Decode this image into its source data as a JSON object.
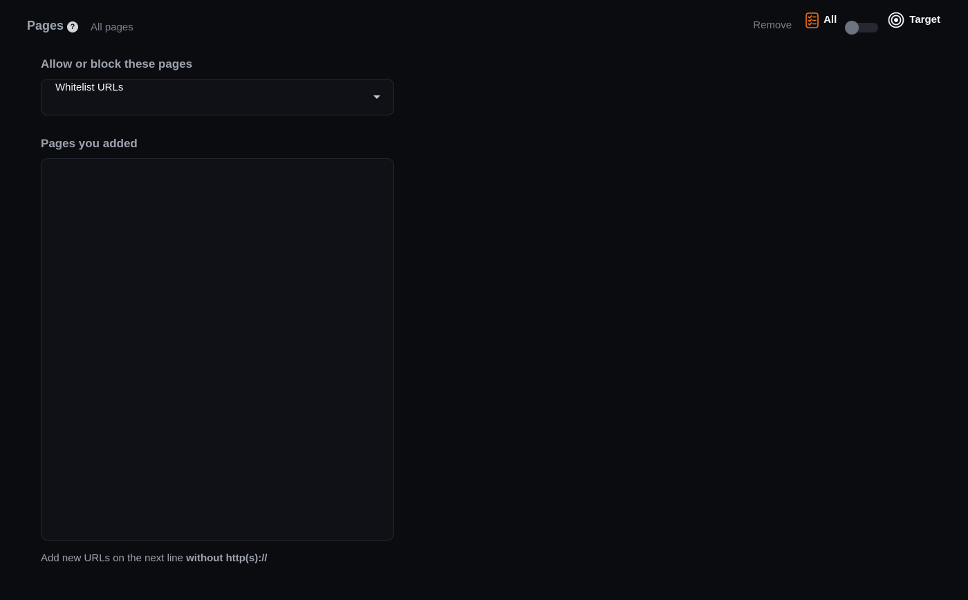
{
  "header": {
    "title": "Pages",
    "help_icon": "question-circle-icon",
    "subtitle": "All pages",
    "remove_label": "Remove",
    "all_label": "All",
    "all_icon": "checklist-icon",
    "target_label": "Target",
    "target_icon": "target-icon",
    "toggle_on": false
  },
  "form": {
    "allow_block_label": "Allow or block these pages",
    "select_value": "Whitelist URLs",
    "pages_added_label": "Pages you added",
    "pages_textarea_value": "",
    "helper_prefix": "Add new URLs on the next line ",
    "helper_bold": "without http(s)://"
  },
  "colors": {
    "background": "#0b0c10",
    "accent_orange": "#f97316",
    "field_background": "#101116",
    "border": "#262830"
  }
}
